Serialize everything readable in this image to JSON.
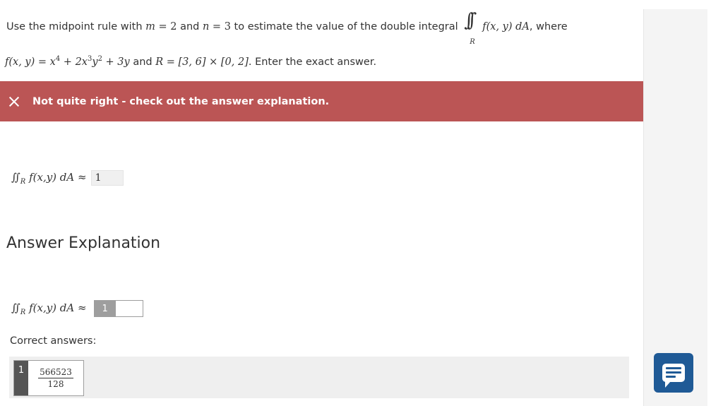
{
  "question": {
    "t1": "Use the midpoint rule with ",
    "m_var": "m",
    "eq1": " = 2",
    "t2": " and ",
    "n_var": "n",
    "eq2": " = 3",
    "t3": " to estimate the value of the double integral ",
    "integral_sign": "∫∫",
    "integral_sub": "R",
    "integrand": "f(x, y) dA",
    "t4": ", where",
    "f_lhs": "f(x, y) = x",
    "exp4": "4",
    "plus2x": " + 2x",
    "exp3": "3",
    "y_var": "y",
    "exp2": "2",
    "plus3y": " + 3y",
    "t5": " and ",
    "R_def": "R = [3, 6] × [0, 2]",
    "t6": ". Enter the exact answer."
  },
  "feedback": {
    "banner_text": "Not quite right - check out the answer explanation.",
    "banner_color": "#bb5555"
  },
  "student_answer": {
    "expr": "∬",
    "expr_sub": "R",
    "expr_rest": " f(x,y) dA ≈",
    "value": "1"
  },
  "explanation": {
    "heading": "Answer Explanation",
    "expr": "∬",
    "expr_sub": "R",
    "expr_rest": " f(x,y) dA ≈",
    "blank_number": "1"
  },
  "correct": {
    "label": "Correct answers:",
    "item_number": "1",
    "numerator": "566523",
    "denominator": "128"
  },
  "chat": {
    "icon": "chat-icon",
    "color": "#1f5a96"
  }
}
